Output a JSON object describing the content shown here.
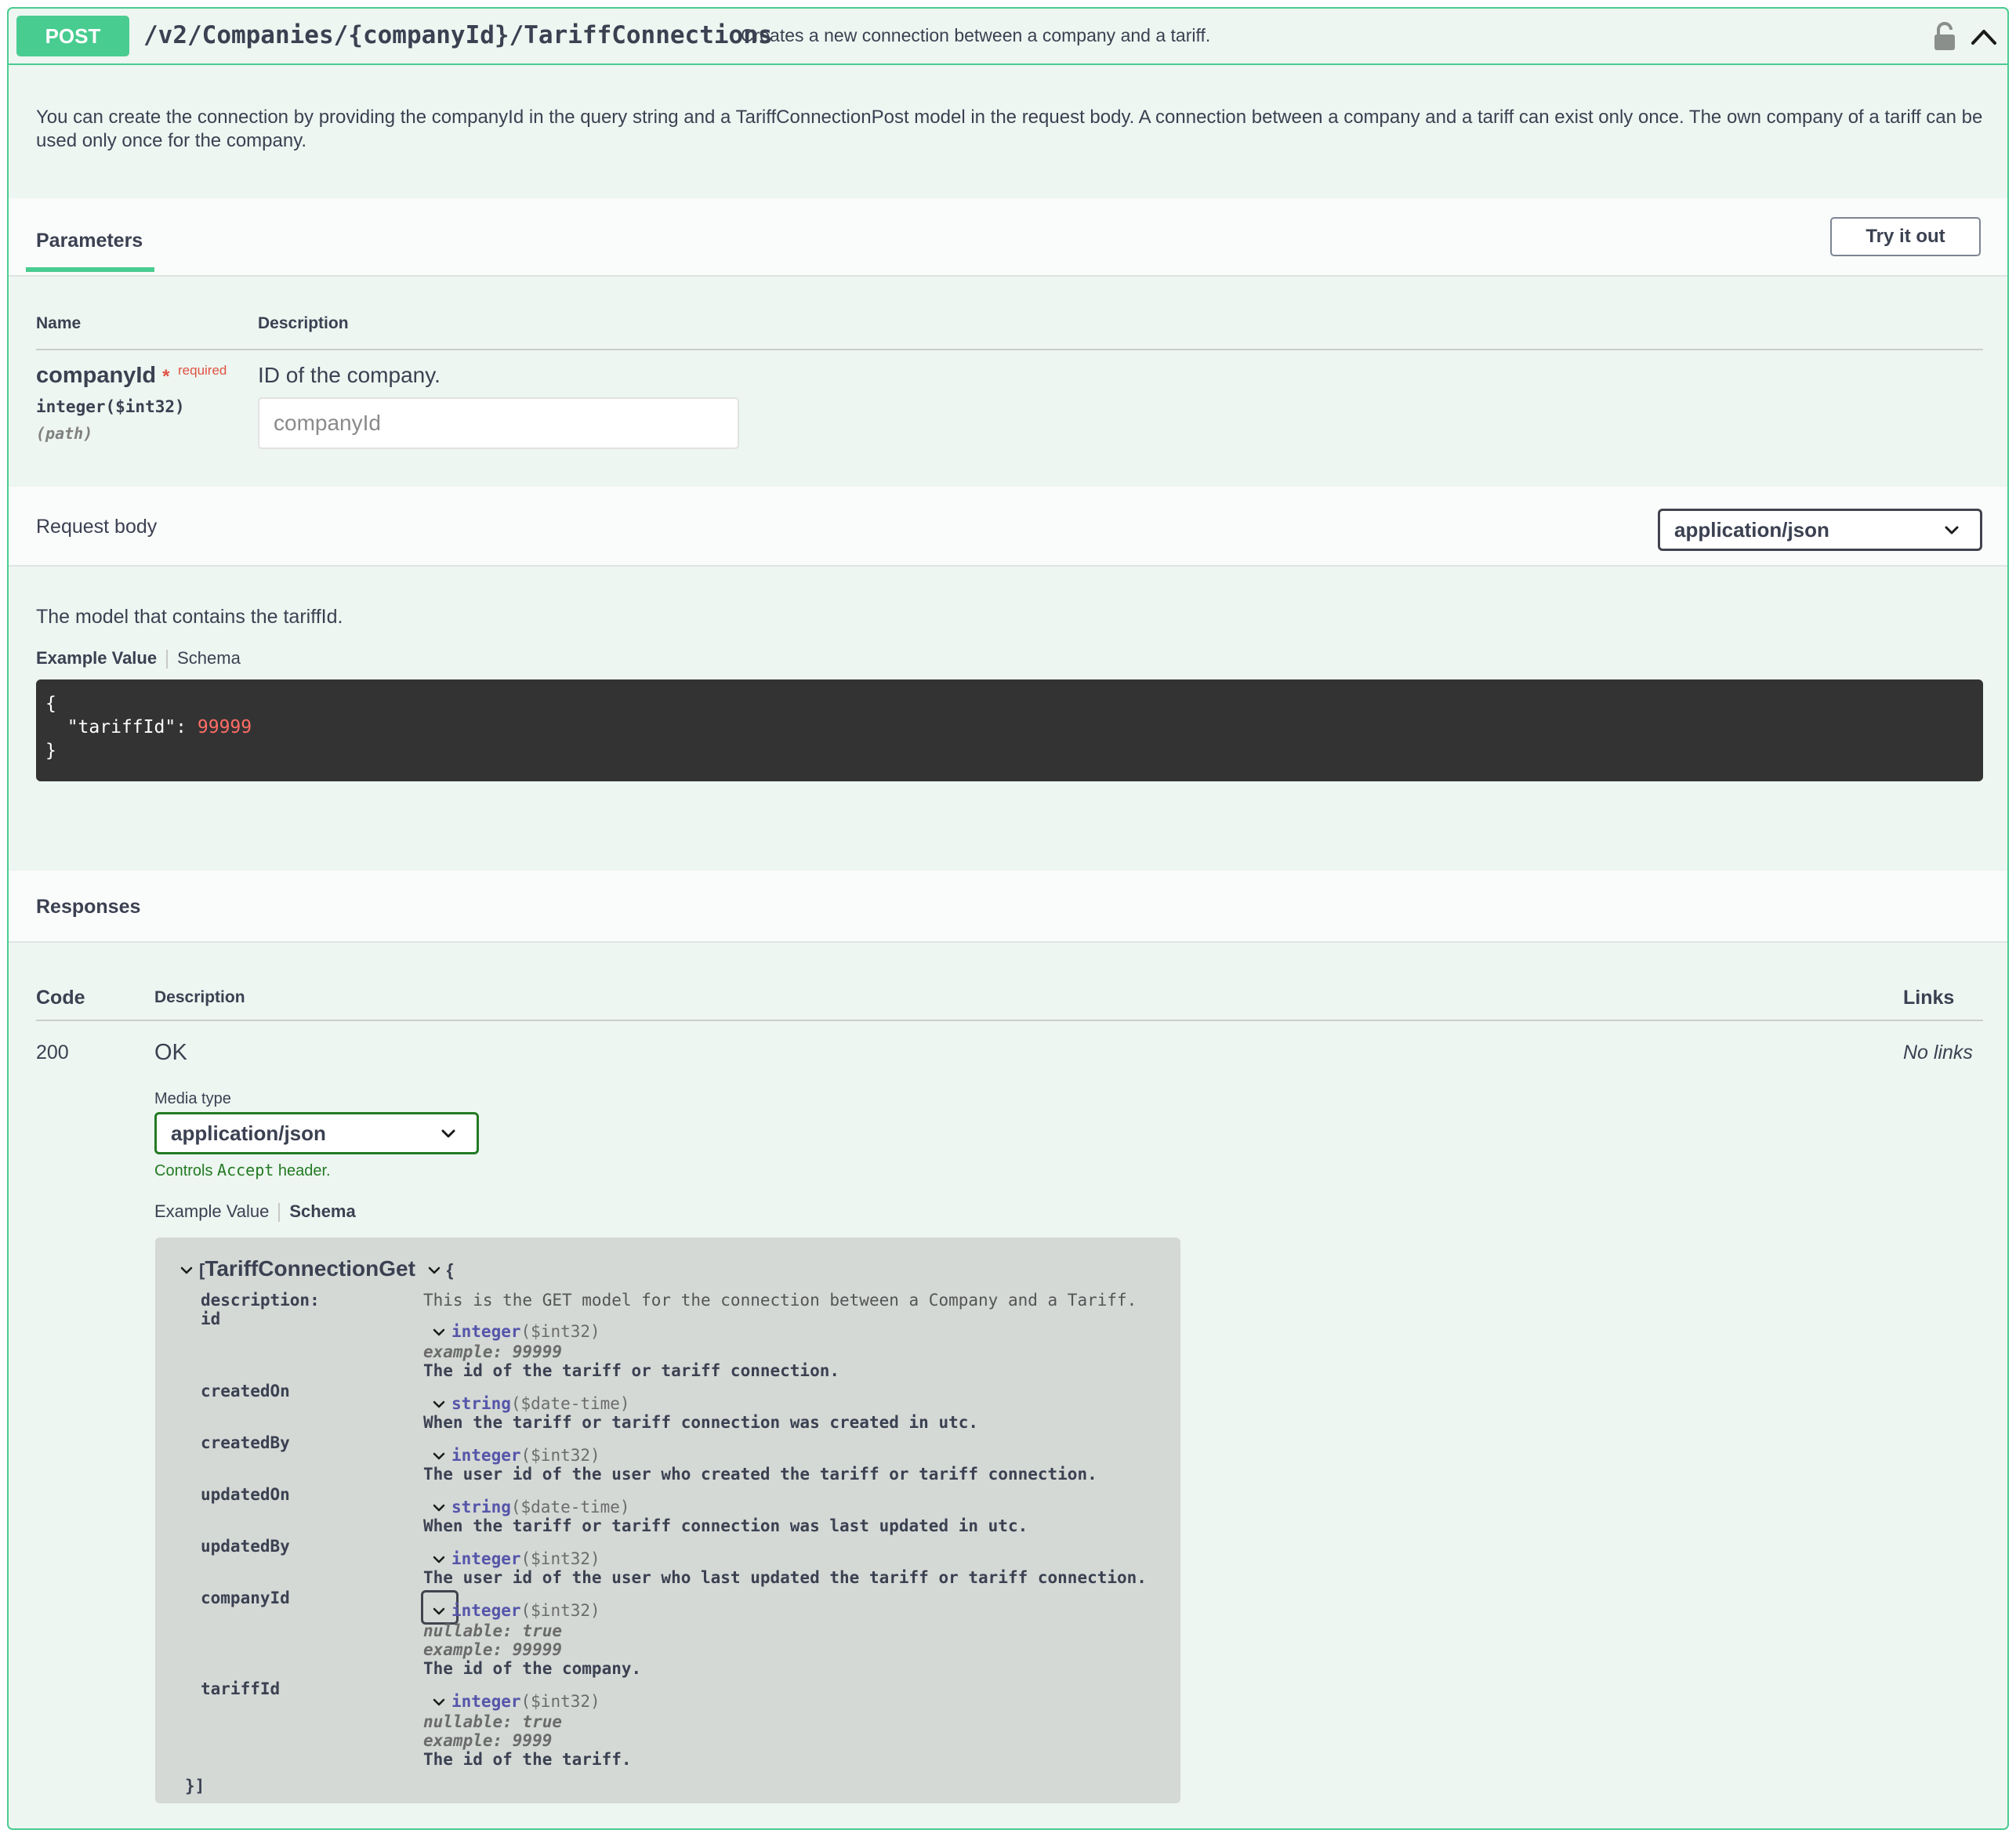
{
  "endpoint": {
    "method": "POST",
    "path": "/v2/Companies/{companyId}/TariffConnections",
    "summary": "Creates a new connection between a company and a tariff.",
    "description": "You can create the connection by providing the companyId in the query string and a TariffConnectionPost model in the request body. A connection between a company and a tariff can exist only once. The own company of a tariff can be used only once for the company."
  },
  "parameters": {
    "tab_label": "Parameters",
    "try_label": "Try it out",
    "col_name": "Name",
    "col_description": "Description",
    "param": {
      "name": "companyId",
      "star": "*",
      "required": "required",
      "type": "integer($int32)",
      "in": "(path)",
      "description": "ID of the company.",
      "placeholder": "companyId"
    }
  },
  "request_body": {
    "label": "Request body",
    "content_type": "application/json",
    "description": "The model that contains the tariffId.",
    "tab_example": "Example Value",
    "tab_schema": "Schema",
    "example_open": "{",
    "example_key": "\"tariffId\": ",
    "example_value": "99999",
    "example_close": "}"
  },
  "responses": {
    "title": "Responses",
    "col_code": "Code",
    "col_description": "Description",
    "col_links": "Links",
    "code": "200",
    "desc": "OK",
    "links": "No links",
    "media_label": "Media type",
    "media_value": "application/json",
    "controls_pre": "Controls ",
    "controls_code": "Accept",
    "controls_post": " header.",
    "tab_example": "Example Value",
    "tab_schema": "Schema"
  },
  "schema": {
    "open_bracket": "[",
    "model": "TariffConnectionGet",
    "open_brace": "{",
    "desc_label": "description:",
    "desc_text": "This is the GET model for the connection between a Company and a Tariff.",
    "close": "}]",
    "props": {
      "id": {
        "name": "id",
        "type": "integer",
        "fmt": "($int32)",
        "example": "example: 99999",
        "desc": "The id of the tariff or tariff connection."
      },
      "createdOn": {
        "name": "createdOn",
        "type": "string",
        "fmt": "($date-time)",
        "desc": "When the tariff or tariff connection was created in utc."
      },
      "createdBy": {
        "name": "createdBy",
        "type": "integer",
        "fmt": "($int32)",
        "desc": "The user id of the user who created the tariff or tariff connection."
      },
      "updatedOn": {
        "name": "updatedOn",
        "type": "string",
        "fmt": "($date-time)",
        "desc": "When the tariff or tariff connection was last updated in utc."
      },
      "updatedBy": {
        "name": "updatedBy",
        "type": "integer",
        "fmt": "($int32)",
        "desc": "The user id of the user who last updated the tariff or tariff connection."
      },
      "companyId": {
        "name": "companyId",
        "type": "integer",
        "fmt": "($int32)",
        "nullable": "nullable: true",
        "example": "example: 99999",
        "desc": "The id of the company."
      },
      "tariffId": {
        "name": "tariffId",
        "type": "integer",
        "fmt": "($int32)",
        "nullable": "nullable: true",
        "example": "example: 9999",
        "desc": "The id of the tariff."
      }
    }
  },
  "colors": {
    "post_green": "#49cc90",
    "background": "#edf6f1",
    "code_bg": "#333333",
    "schema_bg": "#d4d9d6",
    "required_red": "#e05344"
  },
  "icons": [
    "lock-icon",
    "chevron-up-icon",
    "chevron-down-icon"
  ]
}
